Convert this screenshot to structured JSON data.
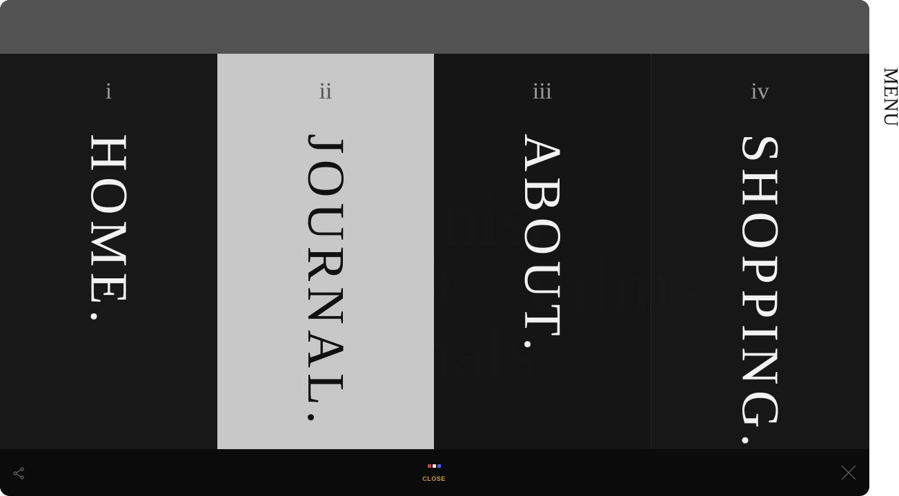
{
  "side_menu": {
    "label": "MENU"
  },
  "background_text": {
    "line1": "nise",
    "line2": "9—Films",
    "line3": "nals."
  },
  "menu_items": [
    {
      "numeral": "i",
      "label": "HOME."
    },
    {
      "numeral": "ii",
      "label": "JOURNAL."
    },
    {
      "numeral": "iii",
      "label": "ABOUT."
    },
    {
      "numeral": "iv",
      "label": "SHOPPING."
    }
  ],
  "bottom_bar": {
    "share_icon": "share-icon",
    "close_label": "CLOSE",
    "close_icon": "close-x-icon",
    "dot_colors": [
      "#d93b3b",
      "#e8e8e8",
      "#5b5be0"
    ]
  },
  "colors": {
    "accent_close": "#c89a3c",
    "active_panel": "#c8c8c8",
    "topbar": "#535353"
  }
}
